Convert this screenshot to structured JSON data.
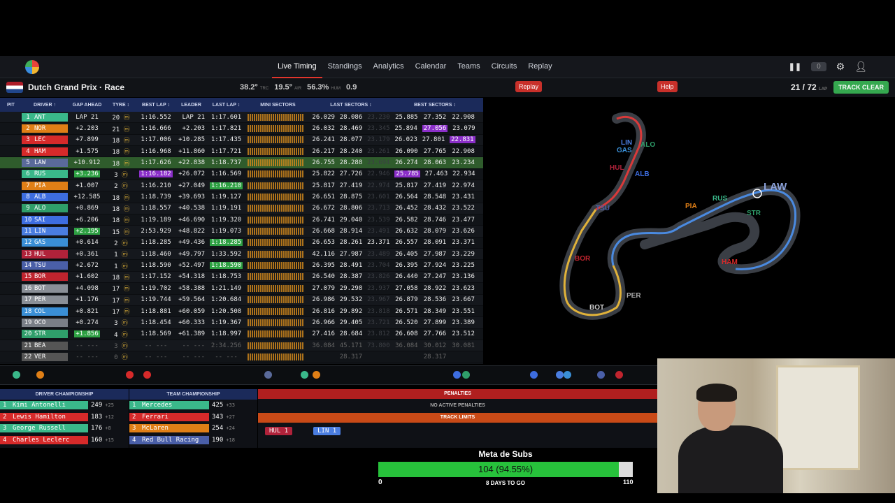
{
  "nav": {
    "items": [
      "Live Timing",
      "Standings",
      "Analytics",
      "Calendar",
      "Teams",
      "Circuits",
      "Replay"
    ],
    "active": "Live Timing",
    "count": "0"
  },
  "race": {
    "title": "Dutch Grand Prix · Race",
    "track_temp": "38.2°",
    "track_label": "TRC",
    "air_temp": "19.5°",
    "air_label": "AIR",
    "humidity": "56.3%",
    "hum_label": "HUM",
    "wind": "0.9",
    "replay_btn": "Replay",
    "help_btn": "Help",
    "lap": "21 / 72",
    "lap_label": "LAP",
    "status": "TRACK CLEAR"
  },
  "headers": [
    "PIT",
    "DRIVER ↑",
    "GAP AHEAD",
    "TYRE ↕",
    "BEST LAP ↕",
    "LEADER",
    "LAST LAP ↕",
    "MINI SECTORS",
    "LAST SECTORS ↕",
    "BEST SECTORS ↕"
  ],
  "rows": [
    {
      "pos": "1",
      "code": "ANT",
      "color": "#3ab88a",
      "gap": "LAP 21",
      "tyre": "20",
      "best": "1:16.552",
      "leader": "LAP 21",
      "last": "1:17.601",
      "ls": [
        "26.029",
        "28.086",
        "23.230"
      ],
      "bs": [
        "25.885",
        "27.352",
        "22.908"
      ]
    },
    {
      "pos": "2",
      "code": "NOR",
      "color": "#e07f16",
      "gap": "+2.203",
      "tyre": "21",
      "best": "1:16.666",
      "leader": "+2.203",
      "last": "1:17.821",
      "ls": [
        "26.032",
        "28.469",
        "23.345"
      ],
      "bs": [
        "25.894",
        "27.056",
        "23.079"
      ]
    },
    {
      "pos": "3",
      "code": "LEC",
      "color": "#d62a2a",
      "gap": "+7.899",
      "tyre": "18",
      "best": "1:17.006",
      "leader": "+10.285",
      "last": "1:17.435",
      "ls": [
        "26.241",
        "28.077",
        "23.179"
      ],
      "bs": [
        "26.023",
        "27.801",
        "22.831"
      ]
    },
    {
      "pos": "4",
      "code": "HAM",
      "color": "#d62a2a",
      "gap": "+1.575",
      "tyre": "18",
      "best": "1:16.968",
      "leader": "+11.860",
      "last": "1:17.721",
      "ls": [
        "26.217",
        "28.240",
        "23.261"
      ],
      "bs": [
        "26.090",
        "27.765",
        "22.908"
      ]
    },
    {
      "pos": "5",
      "code": "LAW",
      "color": "#5a6a9a",
      "gap": "+10.912",
      "tyre": "18",
      "best": "1:17.626",
      "leader": "+22.838",
      "last": "1:18.737",
      "ls": [
        "26.755",
        "28.288",
        "23.694"
      ],
      "bs": [
        "26.274",
        "28.063",
        "23.234"
      ]
    },
    {
      "pos": "6",
      "code": "RUS",
      "color": "#3ab88a",
      "gap": "+3.236",
      "tyre": "3",
      "best": "1:16.182",
      "leader": "+26.072",
      "last": "1:16.569",
      "ls": [
        "25.822",
        "27.726",
        "22.946"
      ],
      "bs": [
        "25.785",
        "27.463",
        "22.934"
      ]
    },
    {
      "pos": "7",
      "code": "PIA",
      "color": "#e07f16",
      "gap": "+1.007",
      "tyre": "2",
      "best": "1:16.210",
      "leader": "+27.049",
      "last": "1:16.210",
      "ls": [
        "25.817",
        "27.419",
        "22.974"
      ],
      "bs": [
        "25.817",
        "27.419",
        "22.974"
      ]
    },
    {
      "pos": "8",
      "code": "ALB",
      "color": "#3d6de0",
      "gap": "+12.585",
      "tyre": "18",
      "best": "1:18.739",
      "leader": "+39.693",
      "last": "1:19.127",
      "ls": [
        "26.651",
        "28.875",
        "23.601"
      ],
      "bs": [
        "26.564",
        "28.548",
        "23.431"
      ]
    },
    {
      "pos": "9",
      "code": "ALO",
      "color": "#2f9e6a",
      "gap": "+0.869",
      "tyre": "18",
      "best": "1:18.557",
      "leader": "+40.538",
      "last": "1:19.191",
      "ls": [
        "26.672",
        "28.806",
        "23.713"
      ],
      "bs": [
        "26.452",
        "28.432",
        "23.522"
      ]
    },
    {
      "pos": "10",
      "code": "SAI",
      "color": "#3d6de0",
      "gap": "+6.206",
      "tyre": "18",
      "best": "1:19.189",
      "leader": "+46.690",
      "last": "1:19.320",
      "ls": [
        "26.741",
        "29.040",
        "23.539"
      ],
      "bs": [
        "26.582",
        "28.746",
        "23.477"
      ]
    },
    {
      "pos": "11",
      "code": "LIN",
      "color": "#4a7de0",
      "gap": "+2.195",
      "tyre": "15",
      "best": "2:53.929",
      "leader": "+48.822",
      "last": "1:19.073",
      "ls": [
        "26.668",
        "28.914",
        "23.491"
      ],
      "bs": [
        "26.632",
        "28.079",
        "23.626"
      ]
    },
    {
      "pos": "12",
      "code": "GAS",
      "color": "#3a8fd6",
      "gap": "+0.614",
      "tyre": "2",
      "best": "1:18.285",
      "leader": "+49.436",
      "last": "1:18.285",
      "ls": [
        "26.653",
        "28.261",
        "23.371"
      ],
      "bs": [
        "26.557",
        "28.091",
        "23.371"
      ]
    },
    {
      "pos": "13",
      "code": "HUL",
      "color": "#b0223a",
      "gap": "+0.361",
      "tyre": "1",
      "best": "1:18.460",
      "leader": "+49.797",
      "last": "1:33.592",
      "ls": [
        "42.116",
        "27.987",
        "23.489"
      ],
      "bs": [
        "26.405",
        "27.987",
        "23.229"
      ]
    },
    {
      "pos": "14",
      "code": "TSU",
      "color": "#4a5fa8",
      "gap": "+2.672",
      "tyre": "1",
      "best": "1:18.590",
      "leader": "+52.497",
      "last": "1:18.590",
      "ls": [
        "26.395",
        "28.491",
        "23.704"
      ],
      "bs": [
        "26.395",
        "27.924",
        "23.225"
      ]
    },
    {
      "pos": "15",
      "code": "BOR",
      "color": "#c0242e",
      "gap": "+1.602",
      "tyre": "18",
      "best": "1:17.152",
      "leader": "+54.318",
      "last": "1:18.753",
      "ls": [
        "26.540",
        "28.387",
        "23.826"
      ],
      "bs": [
        "26.440",
        "27.247",
        "23.136"
      ]
    },
    {
      "pos": "16",
      "code": "BOT",
      "color": "#8a8f97",
      "gap": "+4.098",
      "tyre": "17",
      "best": "1:19.702",
      "leader": "+58.388",
      "last": "1:21.149",
      "ls": [
        "27.079",
        "29.298",
        "23.937"
      ],
      "bs": [
        "27.058",
        "28.922",
        "23.623"
      ]
    },
    {
      "pos": "17",
      "code": "PER",
      "color": "#8a8f97",
      "gap": "+1.176",
      "tyre": "17",
      "best": "1:19.744",
      "leader": "+59.564",
      "last": "1:20.684",
      "ls": [
        "26.986",
        "29.532",
        "23.967"
      ],
      "bs": [
        "26.879",
        "28.536",
        "23.667"
      ]
    },
    {
      "pos": "18",
      "code": "COL",
      "color": "#3a8fd6",
      "gap": "+0.821",
      "tyre": "17",
      "best": "1:18.881",
      "leader": "+60.059",
      "last": "1:20.508",
      "ls": [
        "26.816",
        "29.892",
        "23.818"
      ],
      "bs": [
        "26.571",
        "28.349",
        "23.551"
      ]
    },
    {
      "pos": "19",
      "code": "OCO",
      "color": "#7a7f87",
      "gap": "+0.274",
      "tyre": "3",
      "best": "1:18.454",
      "leader": "+60.333",
      "last": "1:19.367",
      "ls": [
        "26.966",
        "29.405",
        "23.721"
      ],
      "bs": [
        "26.520",
        "27.899",
        "23.389"
      ]
    },
    {
      "pos": "20",
      "code": "STR",
      "color": "#2f9e6a",
      "gap": "+1.856",
      "tyre": "4",
      "best": "1:18.569",
      "leader": "+61.389",
      "last": "1:18.997",
      "ls": [
        "27.416",
        "28.684",
        "23.812"
      ],
      "bs": [
        "26.608",
        "27.766",
        "23.512"
      ]
    },
    {
      "pos": "21",
      "code": "BEA",
      "color": "#555",
      "gap": "-- ---",
      "tyre": "3",
      "best": "-- ---",
      "leader": "-- ---",
      "last": "2:34.256",
      "ls": [
        "36.084",
        "45.171",
        "73.800"
      ],
      "bs": [
        "36.084",
        "30.012",
        "30.081"
      ]
    },
    {
      "pos": "22",
      "code": "VER",
      "color": "#555",
      "gap": "-- ---",
      "tyre": "0",
      "best": "-- ---",
      "leader": "-- ---",
      "last": "-- ---",
      "ls": [
        "",
        "28.317",
        ""
      ],
      "bs": [
        "",
        "28.317",
        ""
      ]
    }
  ],
  "map_labels": [
    "LAW",
    "ALO",
    "ALB",
    "PIA",
    "RUS",
    "TSU",
    "BOR",
    "BOT",
    "PER",
    "LIN",
    "GAS",
    "HUL",
    "HAM",
    "STR"
  ],
  "driver_championship": {
    "title": "DRIVER CHAMPIONSHIP",
    "rows": [
      {
        "pos": "1",
        "name": "Kimi Antonelli",
        "pts": "249",
        "diff": "+25",
        "color": "#3ab88a"
      },
      {
        "pos": "2",
        "name": "Lewis Hamilton",
        "pts": "183",
        "diff": "+12",
        "color": "#d62a2a"
      },
      {
        "pos": "3",
        "name": "George Russell",
        "pts": "176",
        "diff": "+8",
        "color": "#3ab88a"
      },
      {
        "pos": "4",
        "name": "Charles Leclerc",
        "pts": "160",
        "diff": "+15",
        "color": "#d62a2a"
      }
    ]
  },
  "team_championship": {
    "title": "TEAM CHAMPIONSHIP",
    "rows": [
      {
        "pos": "1",
        "name": "Mercedes",
        "pts": "425",
        "diff": "+33",
        "color": "#3ab88a"
      },
      {
        "pos": "2",
        "name": "Ferrari",
        "pts": "343",
        "diff": "+27",
        "color": "#d62a2a"
      },
      {
        "pos": "3",
        "name": "McLaren",
        "pts": "254",
        "diff": "+24",
        "color": "#e07f16"
      },
      {
        "pos": "4",
        "name": "Red Bull Racing",
        "pts": "190",
        "diff": "+18",
        "color": "#4a5fa8"
      }
    ]
  },
  "penalties": {
    "title": "PENALTIES",
    "none": "NO ACTIVE PENALTIES",
    "tl_title": "TRACK LIMITS",
    "tl": [
      {
        "code": "HUL",
        "n": "1",
        "color": "#b0223a"
      },
      {
        "code": "LIN",
        "n": "1",
        "color": "#4a7de0"
      }
    ]
  },
  "subs": {
    "title": "Meta de Subs",
    "value": "104 (94.55%)",
    "progress": 0.9455,
    "min": "0",
    "max": "110",
    "days": "8 DAYS TO GO"
  }
}
